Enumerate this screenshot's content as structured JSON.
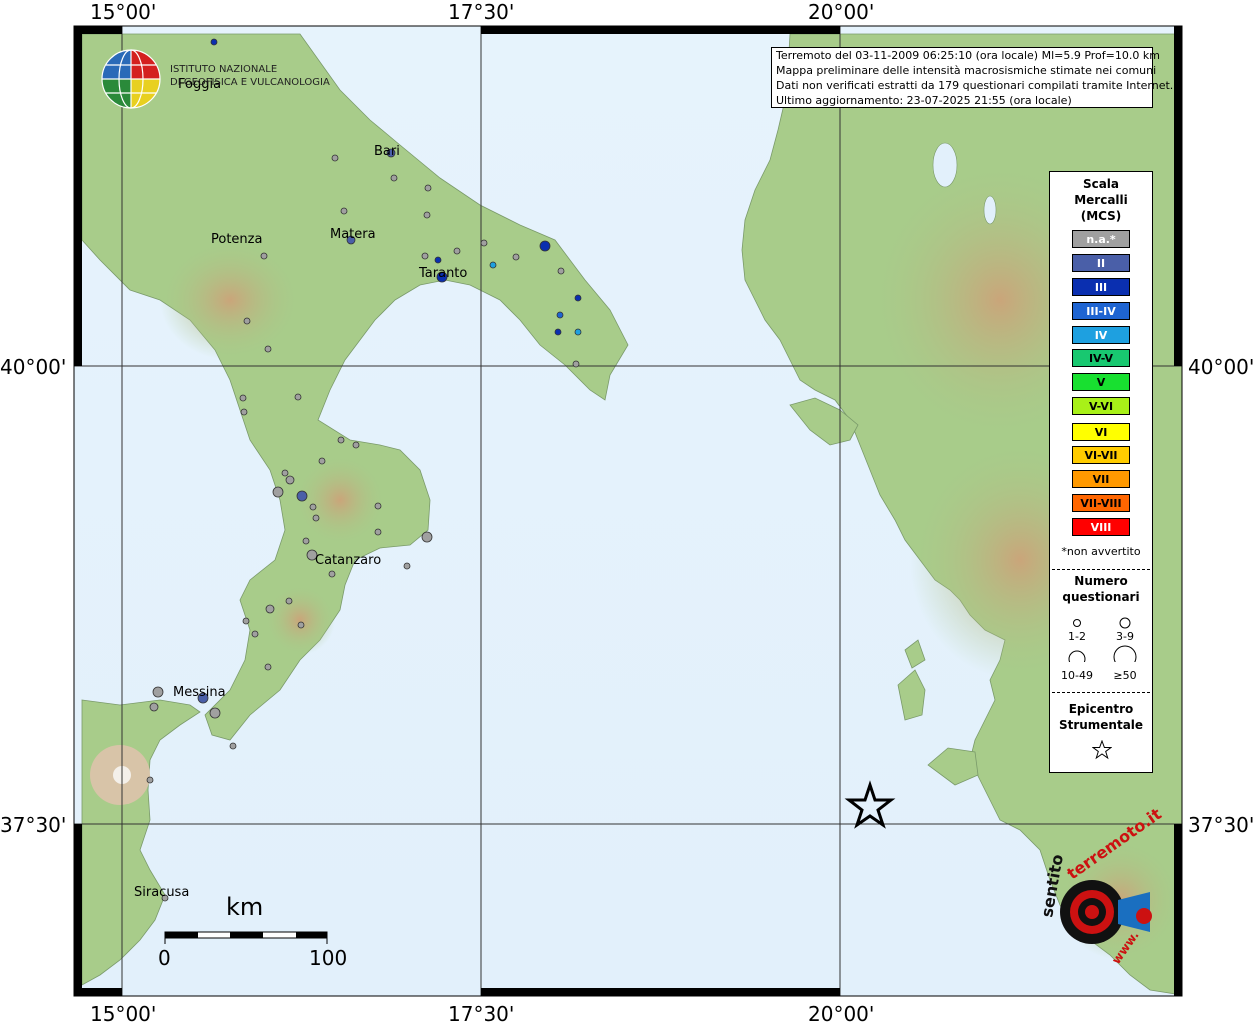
{
  "ticks": {
    "lon_top": [
      "15°00'",
      "17°30'",
      "20°00'"
    ],
    "lon_bottom": [
      "15°00'",
      "17°30'",
      "20°00'"
    ],
    "lat_left": [
      "40°00'",
      "37°30'"
    ],
    "lat_right": [
      "40°00'",
      "37°30'"
    ]
  },
  "institute": {
    "line1": "ISTITUTO NAZIONALE",
    "line2": "DI GEOFISICA E VULCANOLOGIA"
  },
  "info": {
    "line1": "Terremoto del 03-11-2009 06:25:10 (ora locale) Ml=5.9 Prof=10.0 km",
    "line2": "Mappa preliminare delle intensità macrosismiche stimate nei comuni",
    "line3": "Dati non verificati estratti da 179 questionari compilati tramite Internet.",
    "line4": "Ultimo aggiornamento: 23-07-2025 21:55 (ora locale)"
  },
  "cities": {
    "foggia": "Foggia",
    "bari": "Bari",
    "potenza": "Potenza",
    "matera": "Matera",
    "taranto": "Taranto",
    "catanzaro": "Catanzaro",
    "messina": "Messina",
    "siracusa": "Siracusa"
  },
  "legend": {
    "title1": "Scala",
    "title2": "Mercalli",
    "title3": "(MCS)",
    "classes": [
      {
        "label": "n.a.*",
        "color": "#a0a0a0"
      },
      {
        "label": "II",
        "color": "#4a5fa8"
      },
      {
        "label": "III",
        "color": "#0a2fb0"
      },
      {
        "label": "III-IV",
        "color": "#1e64d2"
      },
      {
        "label": "IV",
        "color": "#1ea0e0"
      },
      {
        "label": "IV-V",
        "color": "#18c870"
      },
      {
        "label": "V",
        "color": "#18e030"
      },
      {
        "label": "V-VI",
        "color": "#a8f018"
      },
      {
        "label": "VI",
        "color": "#ffff00"
      },
      {
        "label": "VI-VII",
        "color": "#ffcc00"
      },
      {
        "label": "VII",
        "color": "#ff9900"
      },
      {
        "label": "VII-VIII",
        "color": "#ff6600"
      },
      {
        "label": "VIII",
        "color": "#ff0000"
      }
    ],
    "not_felt": "*non avvertito",
    "count_title1": "Numero",
    "count_title2": "questionari",
    "sizes": [
      "1-2",
      "3-9",
      "10-49",
      "≥50"
    ],
    "epi_title1": "Epicentro",
    "epi_title2": "Strumentale"
  },
  "scalebar": {
    "unit": "km",
    "min": "0",
    "max": "100"
  },
  "watermark": {
    "text1": "sentito",
    "text2": "terremoto.it",
    "text3": "www."
  }
}
